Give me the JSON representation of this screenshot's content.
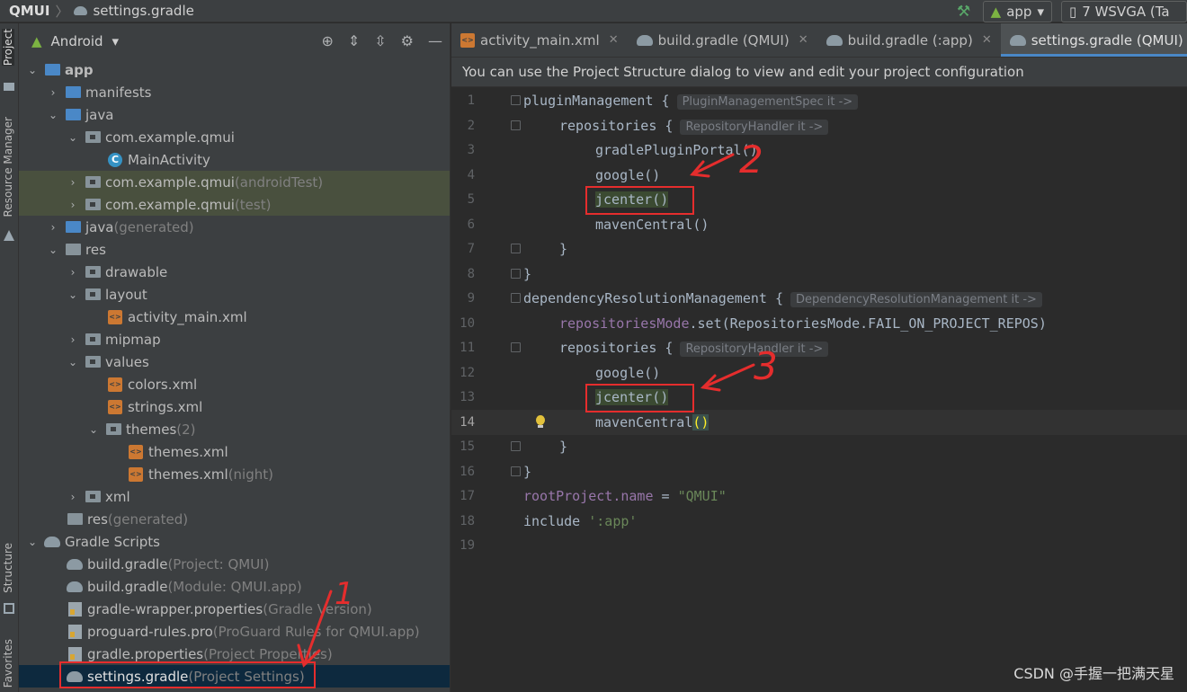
{
  "topbar": {
    "project": "QMUI",
    "file": "settings.gradle",
    "run_config": "app",
    "device": "7  WSVGA (Ta"
  },
  "leftstrip": {
    "project_tab": "Project",
    "resource_tab": "Resource Manager",
    "structure_tab": "Structure",
    "favorites_tab": "Favorites"
  },
  "project": {
    "view_mode": "Android",
    "tree": [
      {
        "label": "app",
        "extra": ""
      },
      {
        "label": "manifests",
        "extra": ""
      },
      {
        "label": "java",
        "extra": ""
      },
      {
        "label": "com.example.qmui",
        "extra": ""
      },
      {
        "label": "MainActivity",
        "extra": ""
      },
      {
        "label": "com.example.qmui",
        "extra": " (androidTest)"
      },
      {
        "label": "com.example.qmui",
        "extra": " (test)"
      },
      {
        "label": "java",
        "extra": " (generated)"
      },
      {
        "label": "res",
        "extra": ""
      },
      {
        "label": "drawable",
        "extra": ""
      },
      {
        "label": "layout",
        "extra": ""
      },
      {
        "label": "activity_main.xml",
        "extra": ""
      },
      {
        "label": "mipmap",
        "extra": ""
      },
      {
        "label": "values",
        "extra": ""
      },
      {
        "label": "colors.xml",
        "extra": ""
      },
      {
        "label": "strings.xml",
        "extra": ""
      },
      {
        "label": "themes",
        "extra": " (2)"
      },
      {
        "label": "themes.xml",
        "extra": ""
      },
      {
        "label": "themes.xml",
        "extra": " (night)"
      },
      {
        "label": "xml",
        "extra": ""
      },
      {
        "label": "res",
        "extra": " (generated)"
      },
      {
        "label": "Gradle Scripts",
        "extra": ""
      },
      {
        "label": "build.gradle",
        "extra": " (Project: QMUI)"
      },
      {
        "label": "build.gradle",
        "extra": " (Module: QMUI.app)"
      },
      {
        "label": "gradle-wrapper.properties",
        "extra": " (Gradle Version)"
      },
      {
        "label": "proguard-rules.pro",
        "extra": " (ProGuard Rules for QMUI.app)"
      },
      {
        "label": "gradle.properties",
        "extra": " (Project Properties)"
      },
      {
        "label": "settings.gradle",
        "extra": " (Project Settings)"
      }
    ]
  },
  "editor": {
    "tabs": [
      {
        "label": "activity_main.xml"
      },
      {
        "label": "build.gradle (QMUI)"
      },
      {
        "label": "build.gradle (:app)"
      },
      {
        "label": "settings.gradle (QMUI)"
      }
    ],
    "banner": "You can use the Project Structure dialog to view and edit your project configuration",
    "lines": {
      "l1": "pluginManagement {",
      "l1_hint": "PluginManagementSpec it ->",
      "l2": "repositories {",
      "l2_hint": "RepositoryHandler it ->",
      "l3": "gradlePluginPortal()",
      "l4": "google()",
      "l5": "jcenter()",
      "l6": "mavenCentral()",
      "l7": "}",
      "l8": "}",
      "l9": "dependencyResolutionManagement {",
      "l9_hint": "DependencyResolutionManagement it ->",
      "l10_a": "repositoriesMode",
      "l10_b": ".set(RepositoriesMode.FAIL_ON_PROJECT_REPOS)",
      "l11": "repositories {",
      "l11_hint": "RepositoryHandler it ->",
      "l12": "google()",
      "l13": "jcenter()",
      "l14_a": "mavenCentral",
      "l14_b": "()",
      "l15": "}",
      "l16": "}",
      "l17_a": "rootProject.name",
      "l17_b": " = ",
      "l17_c": "\"QMUI\"",
      "l18_a": "include ",
      "l18_b": "':app'"
    },
    "line_numbers": [
      "1",
      "2",
      "3",
      "4",
      "5",
      "6",
      "7",
      "8",
      "9",
      "10",
      "11",
      "12",
      "13",
      "14",
      "15",
      "16",
      "17",
      "18",
      "19"
    ]
  },
  "annotations": {
    "mark1": "1",
    "mark2": "2",
    "mark3": "3"
  },
  "watermark": "CSDN @手握一把满天星",
  "colors": {
    "accent": "#4a88c7",
    "annotation_red": "#e52d2d",
    "selection": "#0d293e",
    "editor_bg": "#2b2b2b",
    "panel_bg": "#3c3f41"
  }
}
